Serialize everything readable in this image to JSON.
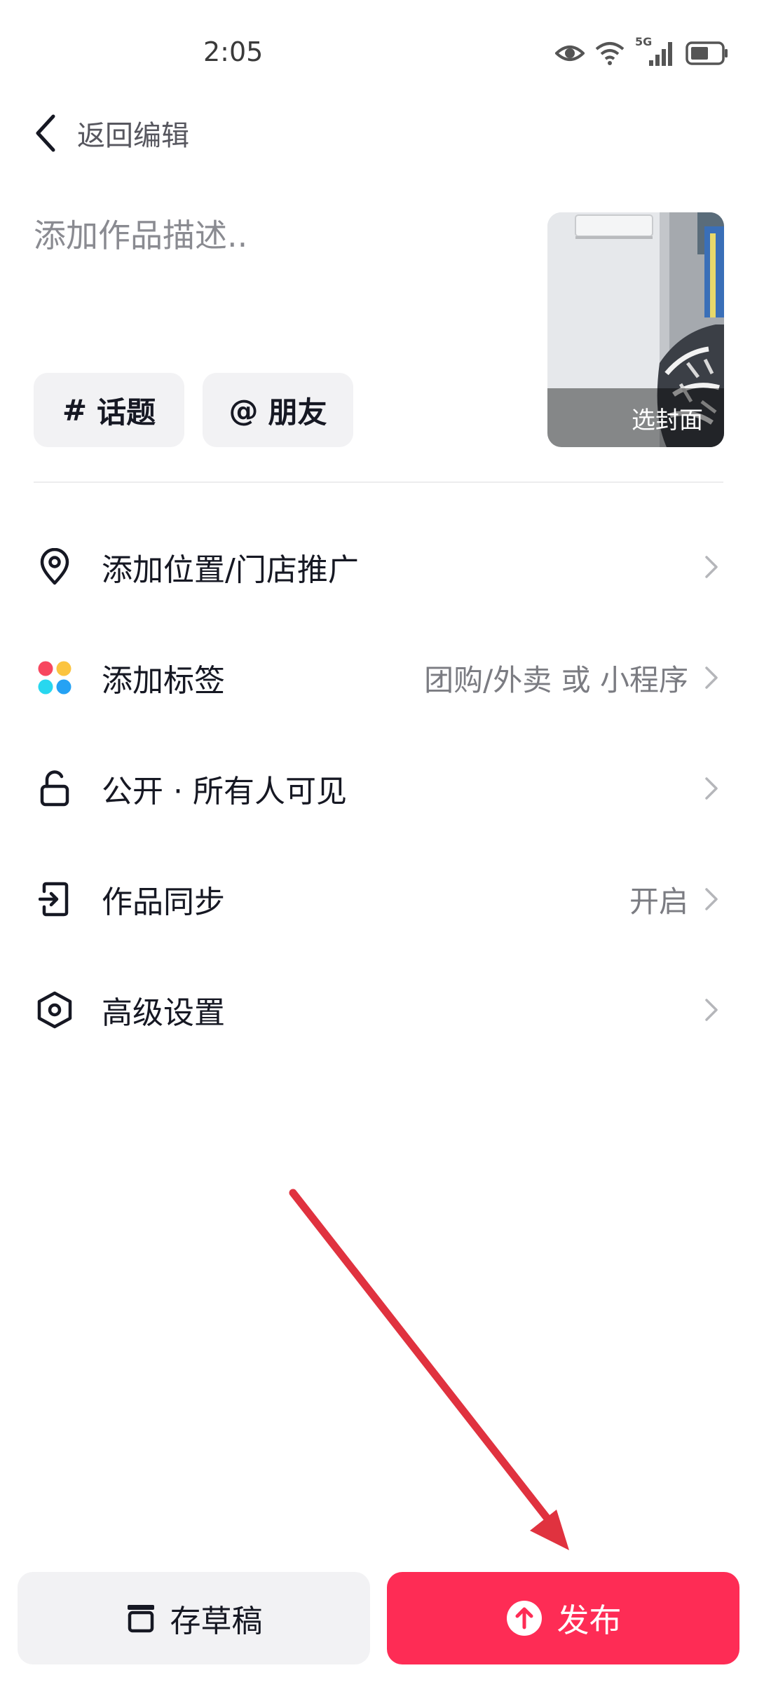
{
  "status_bar": {
    "time": "2:05",
    "network_label": "5G"
  },
  "header": {
    "back_label": "返回编辑"
  },
  "description": {
    "placeholder": "添加作品描述.."
  },
  "chips": [
    {
      "symbol": "#",
      "label": "话题"
    },
    {
      "symbol": "@",
      "label": "朋友"
    }
  ],
  "cover": {
    "label": "选封面"
  },
  "settings": [
    {
      "label": "添加位置/门店推广",
      "value": "",
      "icon": "location-pin-icon"
    },
    {
      "label": "添加标签",
      "value": "团购/外卖 或 小程序",
      "icon": "colored-dots-icon"
    },
    {
      "label": "公开 · 所有人可见",
      "value": "",
      "icon": "unlock-icon"
    },
    {
      "label": "作品同步",
      "value": "开启",
      "icon": "sync-icon"
    },
    {
      "label": "高级设置",
      "value": "",
      "icon": "hexagon-settings-icon"
    }
  ],
  "bottom": {
    "draft_label": "存草稿",
    "publish_label": "发布"
  },
  "colors": {
    "accent": "#fe2c55",
    "annotation_arrow": "#e0323f",
    "tag_dots": [
      "#f7475f",
      "#fbc440",
      "#28d7ef",
      "#25a2f4"
    ]
  }
}
